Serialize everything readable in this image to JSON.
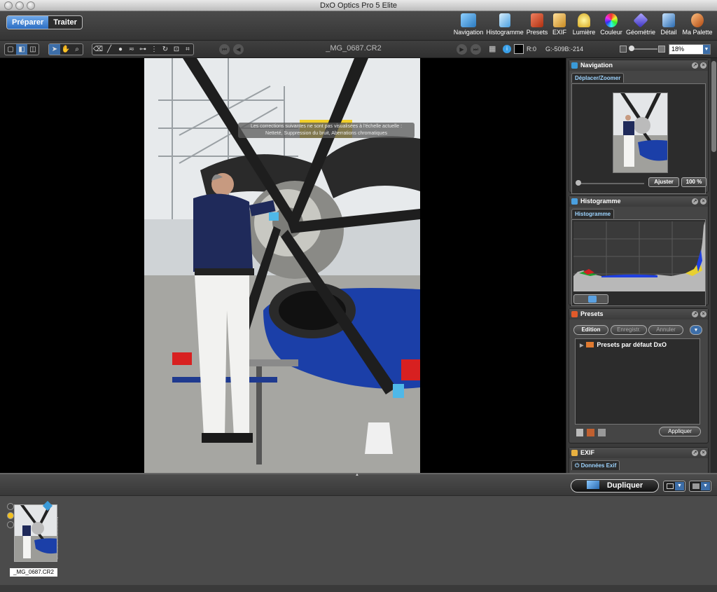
{
  "window": {
    "title": "DxO Optics Pro 5 Elite"
  },
  "modes": {
    "prepare": "Préparer",
    "process": "Traiter"
  },
  "palettes": [
    {
      "label": "Navigation",
      "icon": "navigation-icon",
      "color": "#3a9ad8"
    },
    {
      "label": "Histogramme",
      "icon": "histogram-icon",
      "color": "#4aa0e0"
    },
    {
      "label": "Presets",
      "icon": "presets-icon",
      "color": "#e05a2a"
    },
    {
      "label": "EXIF",
      "icon": "exif-icon",
      "color": "#e8b040"
    },
    {
      "label": "Lumière",
      "icon": "light-icon",
      "color": "#f2d040"
    },
    {
      "label": "Couleur",
      "icon": "color-icon",
      "color": "#d040c8"
    },
    {
      "label": "Géométrie",
      "icon": "geometry-icon",
      "color": "#5a50e0"
    },
    {
      "label": "Détail",
      "icon": "detail-icon",
      "color": "#3a8ad0"
    },
    {
      "label": "Ma Palette",
      "icon": "my-palette-icon",
      "color": "#d86a2a"
    }
  ],
  "subtoolbar": {
    "filename": "_MG_0687.CR2",
    "r_value": "R:0",
    "gb_values": "G:-509B:-214",
    "zoom": "18%"
  },
  "viewer": {
    "notice_line1": "Les corrections suivantes ne sont pas visualisées à l'échelle actuelle :",
    "notice_line2": "Netteté, Suppression du bruit, Aberrations chromatiques"
  },
  "navigation_palette": {
    "title": "Navigation",
    "tab": "Déplacer/Zoomer",
    "fit_button": "Ajuster",
    "zoom_button": "100 %"
  },
  "histogram_palette": {
    "title": "Histogramme",
    "tab": "Histogramme"
  },
  "presets_palette": {
    "title": "Presets",
    "edit": "Edition",
    "save": "Enregistr.",
    "cancel": "Annuler",
    "tree_item": "Presets par défaut DxO",
    "apply": "Appliquer"
  },
  "exif_palette": {
    "title": "EXIF",
    "tab": "Données Exif"
  },
  "filmstrip": {
    "duplicate": "Dupliquer",
    "thumb_name": "_MG_0687.CR2"
  }
}
